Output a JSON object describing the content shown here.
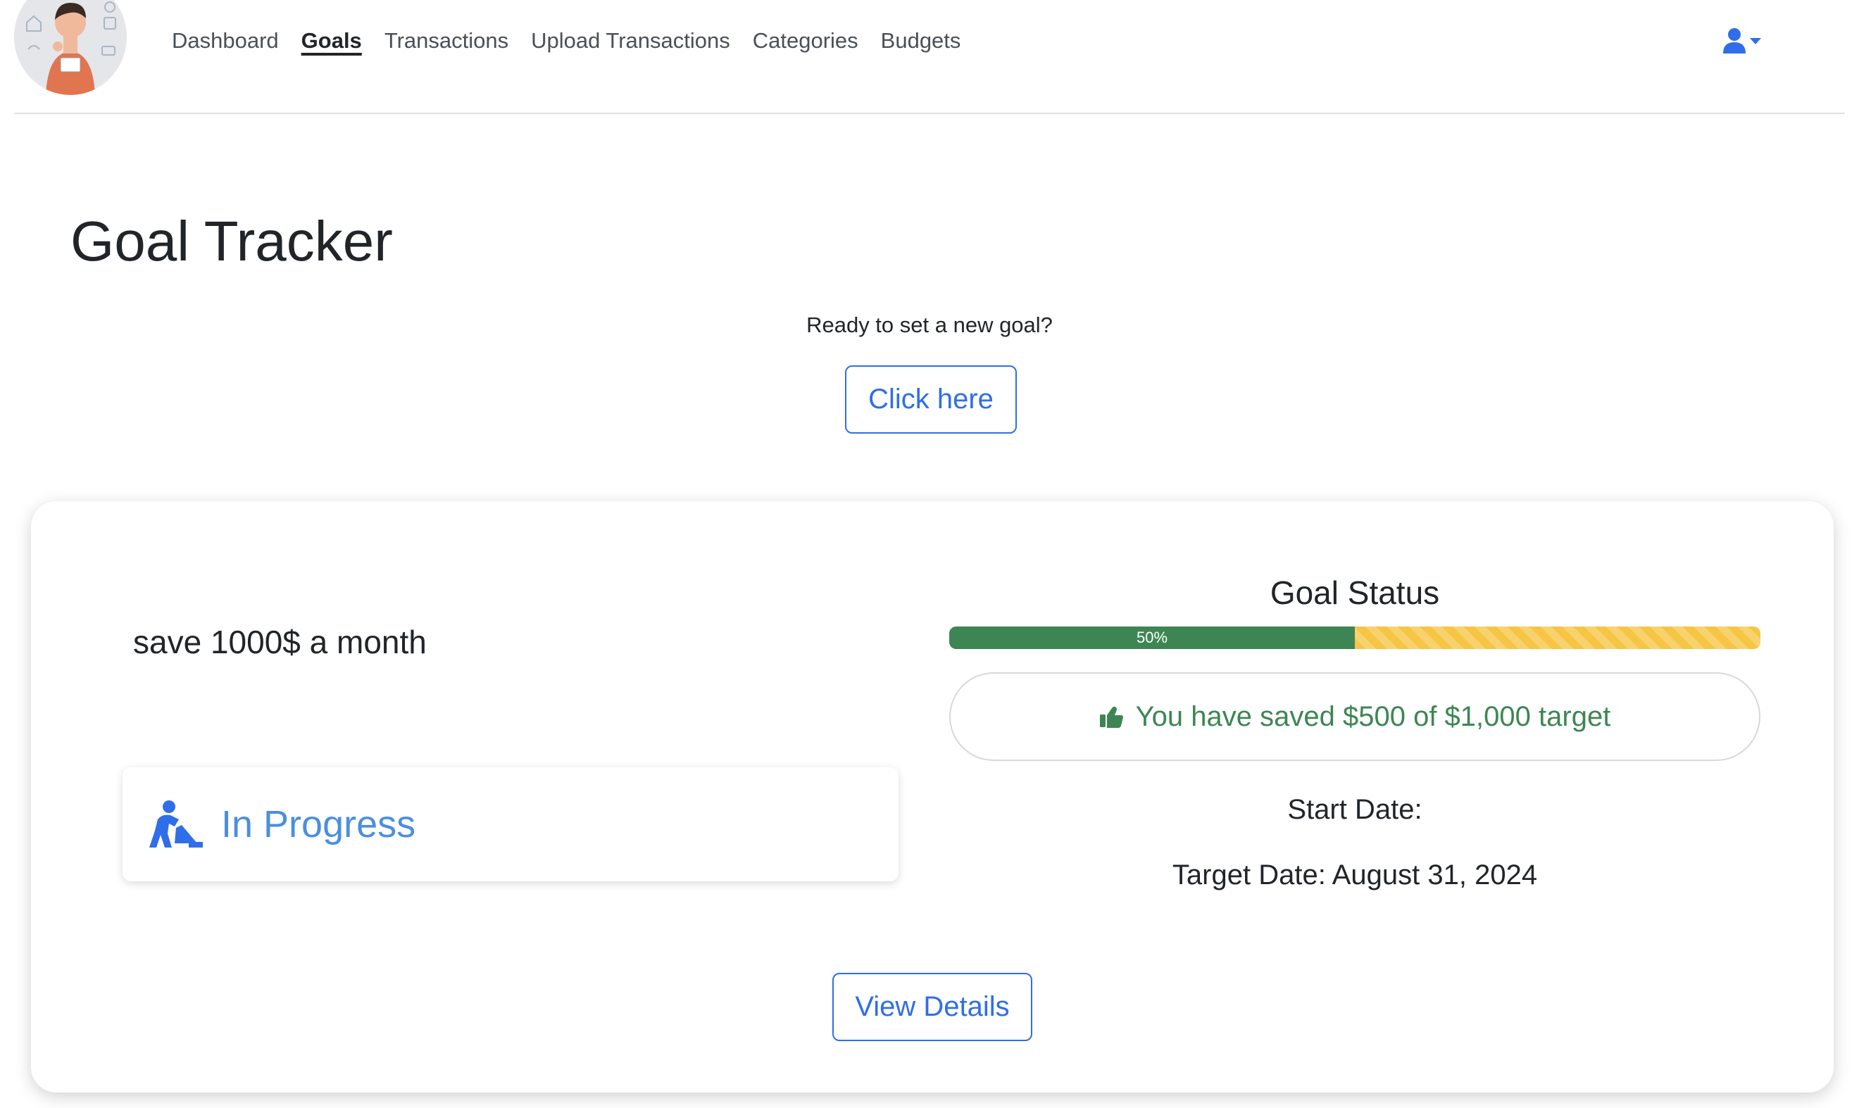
{
  "nav": {
    "links": [
      {
        "label": "Dashboard",
        "active": false
      },
      {
        "label": "Goals",
        "active": true
      },
      {
        "label": "Transactions",
        "active": false
      },
      {
        "label": "Upload Transactions",
        "active": false
      },
      {
        "label": "Categories",
        "active": false
      },
      {
        "label": "Budgets",
        "active": false
      }
    ],
    "user_icon": "user-icon",
    "dropdown_icon": "caret-down-icon"
  },
  "header": {
    "title": "Goal Tracker",
    "prompt": "Ready to set a new goal?",
    "create_button": "Click here"
  },
  "goal": {
    "name": "save 1000$ a month",
    "status": "In Progress",
    "status_icon": "person-digging-icon",
    "status_heading": "Goal Status",
    "progress": {
      "percent": 50,
      "label": "50%"
    },
    "saved_icon": "thumbs-up-icon",
    "saved_message": "You have saved $500 of $1,000 target",
    "start_date_label": "Start Date:",
    "target_date_label": "Target Date: August 31, 2024",
    "details_button": "View Details"
  },
  "colors": {
    "primary": "#2f6ee8",
    "success": "#3d8654",
    "warning": "#f6c544",
    "status_blue": "#4a8fe0"
  }
}
